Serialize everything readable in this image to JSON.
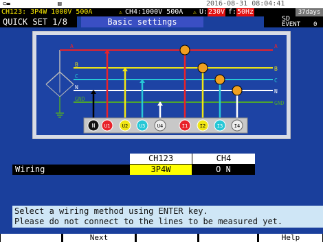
{
  "status": {
    "channel_config": "CH123:  3P4W   1000V   500A",
    "ch4_config": "CH4:1000V   500A",
    "u_label": "U:",
    "u_value": "230V",
    "f_label": "f:",
    "f_value": "50Hz",
    "datetime": "2016-08-31 08:04:41",
    "sd_label": "SD",
    "sd_days": "37days",
    "event_label": "EVENT",
    "event_count": "0"
  },
  "header": {
    "quick_set": "QUICK SET 1/8",
    "page_title": "Basic settings"
  },
  "diagram": {
    "line_labels_left": [
      "A",
      "B",
      "C",
      "N",
      "GND"
    ],
    "line_labels_right": [
      "A",
      "B",
      "C",
      "N",
      "GND"
    ],
    "terminals": [
      "N",
      "U1",
      "U2",
      "U3",
      "U4",
      "I1",
      "I2",
      "I3",
      "I4"
    ]
  },
  "wiring": {
    "row_label": "Wiring",
    "col_ch123": "CH123",
    "col_ch4": "CH4",
    "ch123_value": "3P4W",
    "ch4_value": "O N"
  },
  "message": {
    "line1": "Select a wiring method using ENTER key.",
    "line2": "Please do not connect to the lines to be measured yet."
  },
  "fkeys": {
    "f2": "Next",
    "f5": "Help"
  },
  "colors": {
    "background": "#1a3f9c",
    "phase_a": "#e8222a",
    "phase_b": "#f0e614",
    "phase_c": "#27c7d6",
    "neutral": "#ffffff",
    "ground": "#4ea52e",
    "highlight": "#ffff00"
  }
}
